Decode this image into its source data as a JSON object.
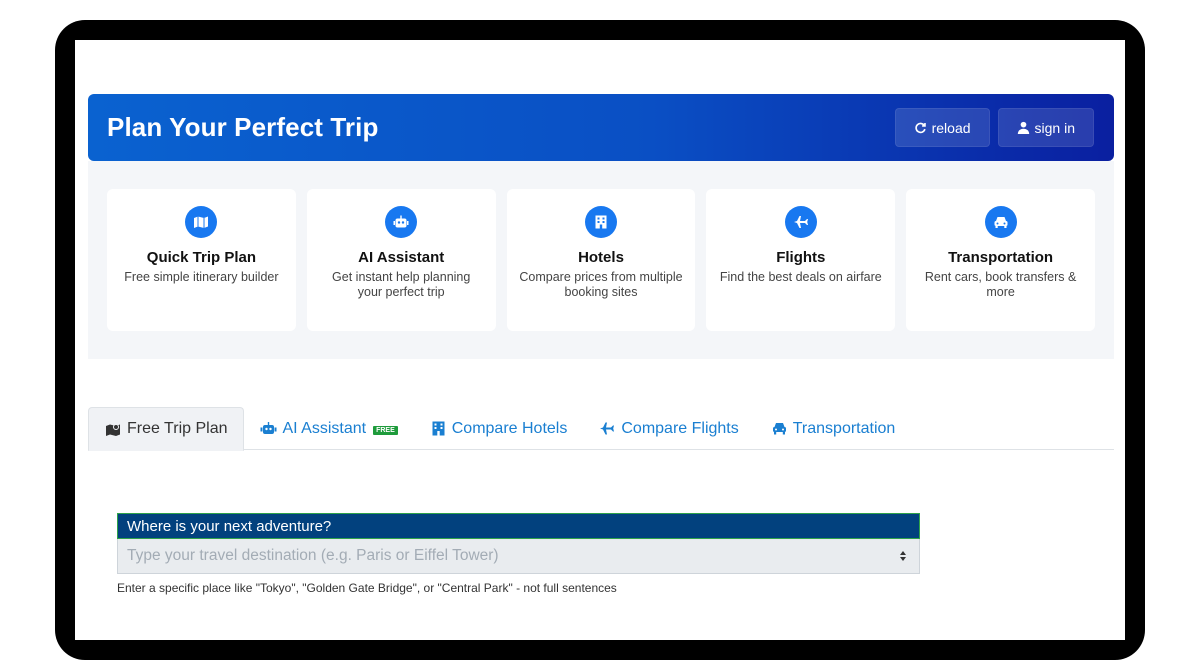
{
  "header": {
    "title": "Plan Your Perfect Trip",
    "reload_label": "reload",
    "signin_label": "sign in",
    "gradient_start": "#0a62d0",
    "gradient_end": "#0a1fa0"
  },
  "features": [
    {
      "icon": "map-icon",
      "title": "Quick Trip Plan",
      "desc": "Free simple itinerary builder"
    },
    {
      "icon": "robot-icon",
      "title": "AI Assistant",
      "desc": "Get instant help planning your perfect trip"
    },
    {
      "icon": "hotel-icon",
      "title": "Hotels",
      "desc": "Compare prices from multiple booking sites"
    },
    {
      "icon": "plane-icon",
      "title": "Flights",
      "desc": "Find the best deals on airfare"
    },
    {
      "icon": "car-icon",
      "title": "Transportation",
      "desc": "Rent cars, book transfers & more"
    }
  ],
  "tabs": [
    {
      "icon": "map-icon",
      "label": "Free Trip Plan",
      "active": true
    },
    {
      "icon": "robot-icon",
      "label": "AI Assistant",
      "badge": "FREE"
    },
    {
      "icon": "hotel-icon",
      "label": "Compare Hotels"
    },
    {
      "icon": "plane-icon",
      "label": "Compare Flights"
    },
    {
      "icon": "car-icon",
      "label": "Transportation"
    }
  ],
  "destination": {
    "label": "Where is your next adventure?",
    "placeholder": "Type your travel destination (e.g. Paris or Eiffel Tower)",
    "hint": "Enter a specific place like \"Tokyo\", \"Golden Gate Bridge\", or \"Central Park\" - not full sentences"
  },
  "colors": {
    "accent": "#1878f0",
    "link": "#1a7fd1",
    "label_bg": "#02417e",
    "badge": "#1e9b3b"
  }
}
